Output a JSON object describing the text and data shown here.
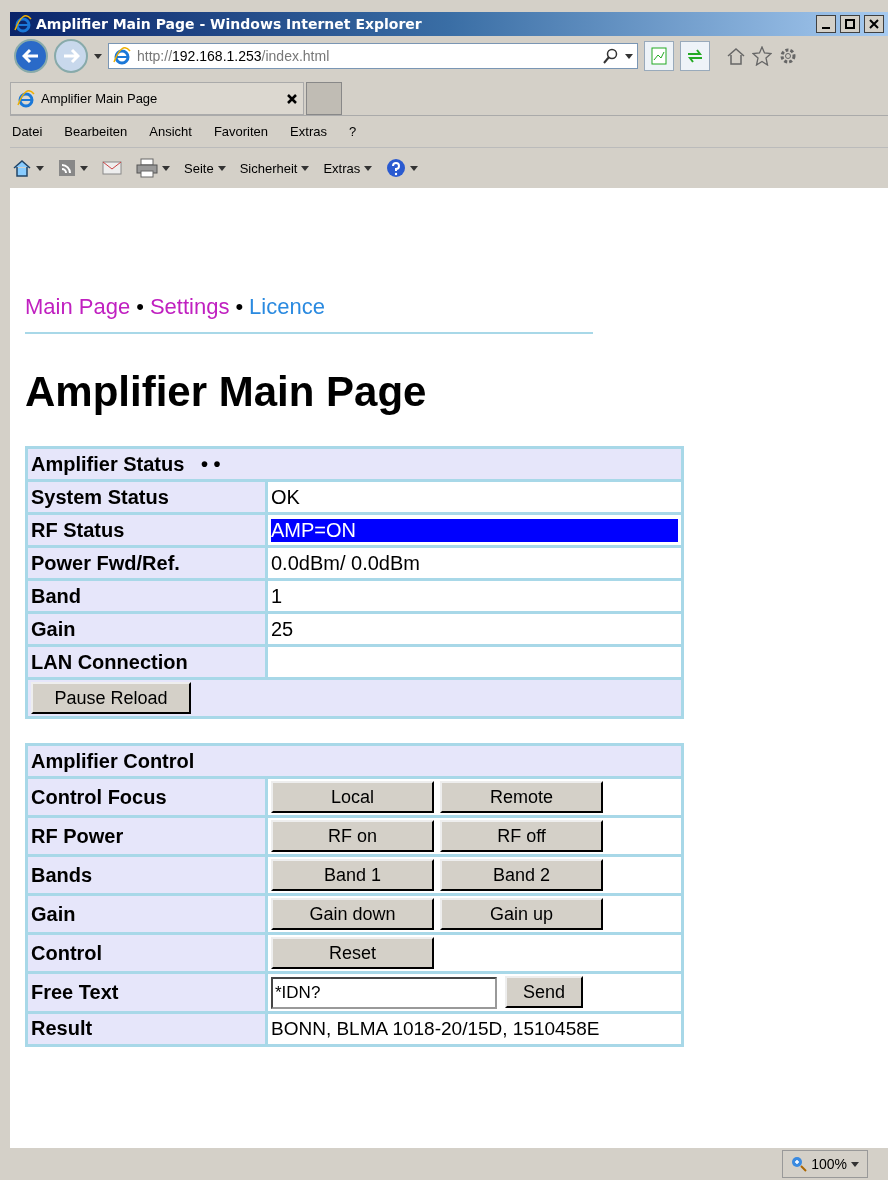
{
  "window": {
    "title": "Amplifier Main Page - Windows Internet Explorer"
  },
  "address_bar": {
    "url_prefix": "http://",
    "url_host": "192.168.1.253",
    "url_path": "/index.html"
  },
  "tabs": [
    {
      "label": "Amplifier Main Page",
      "selected": true
    }
  ],
  "menu": [
    "Datei",
    "Bearbeiten",
    "Ansicht",
    "Favoriten",
    "Extras",
    "?"
  ],
  "command_bar": [
    {
      "kind": "icon"
    },
    {
      "kind": "icon"
    },
    {
      "kind": "icon"
    },
    {
      "kind": "icon"
    },
    {
      "kind": "text",
      "label": "Seite"
    },
    {
      "kind": "text",
      "label": "Sicherheit"
    },
    {
      "kind": "text",
      "label": "Extras"
    },
    {
      "kind": "icon"
    }
  ],
  "nav": [
    {
      "label": "Main Page",
      "visited": true
    },
    {
      "label": "•",
      "kind": "separator"
    },
    {
      "label": "Settings",
      "visited": true
    },
    {
      "label": "•",
      "kind": "separator"
    },
    {
      "label": "Licence",
      "visited": false
    }
  ],
  "heading": "Amplifier Main Page",
  "status_table": {
    "title": "Amplifier Status",
    "indicator": "• •",
    "rows": [
      {
        "label": "System Status",
        "value": "OK"
      },
      {
        "label": "RF Status",
        "value": "AMP=ON",
        "highlighted": true
      },
      {
        "label": "Power Fwd/Ref.",
        "value": "0.0dBm/ 0.0dBm"
      },
      {
        "label": "Band",
        "value": "1"
      },
      {
        "label": "Gain",
        "value": "25"
      },
      {
        "label": "LAN Connection"
      }
    ],
    "button": "Pause Reload"
  },
  "control_table": {
    "title": "Amplifier Control",
    "rows": [
      {
        "label": "Control Focus",
        "kind": "buttons",
        "buttons": [
          "Local",
          "Remote"
        ]
      },
      {
        "label": "RF Power",
        "kind": "buttons",
        "buttons": [
          "RF on",
          "RF off"
        ]
      },
      {
        "label": "Bands",
        "kind": "buttons",
        "buttons": [
          "Band 1",
          "Band 2"
        ]
      },
      {
        "label": "Gain",
        "kind": "buttons",
        "buttons": [
          "Gain down",
          "Gain up"
        ]
      },
      {
        "label": "Control",
        "kind": "buttons",
        "buttons": [
          "Reset"
        ]
      },
      {
        "label": "Free Text",
        "kind": "input",
        "value": "*IDN?",
        "button": "Send"
      },
      {
        "label": "Result",
        "kind": "text",
        "value": "BONN, BLMA 1018-20/15D, 1510458E"
      }
    ]
  },
  "status_bar": {
    "zoom": "100%"
  }
}
